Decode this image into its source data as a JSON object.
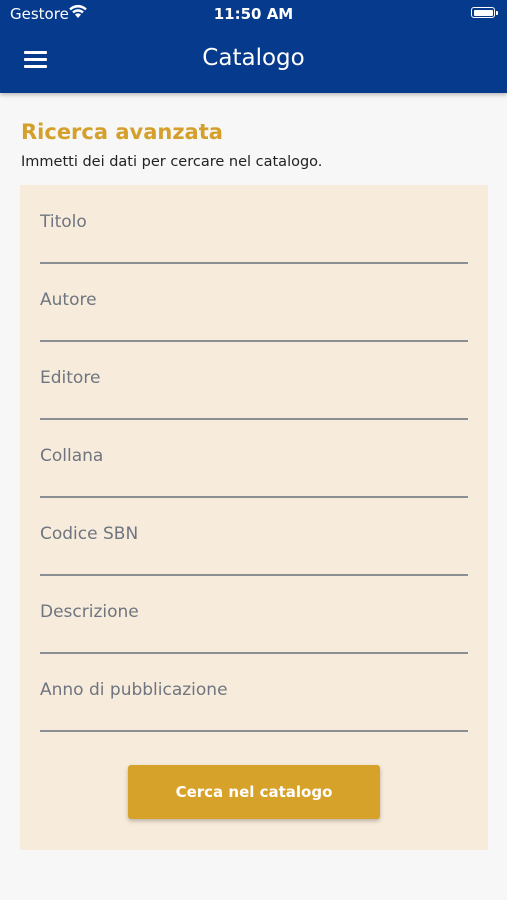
{
  "status_bar": {
    "carrier": "Gestore",
    "time": "11:50 AM",
    "wifi_icon": "wifi-icon",
    "battery_icon": "battery-icon"
  },
  "header": {
    "menu_icon": "hamburger-menu-icon",
    "title": "Catalogo"
  },
  "search": {
    "title": "Ricerca avanzata",
    "subtitle": "Immetti dei dati per cercare nel catalogo.",
    "fields": [
      {
        "label": "Titolo",
        "value": ""
      },
      {
        "label": "Autore",
        "value": ""
      },
      {
        "label": "Editore",
        "value": ""
      },
      {
        "label": "Collana",
        "value": ""
      },
      {
        "label": "Codice SBN",
        "value": ""
      },
      {
        "label": "Descrizione",
        "value": ""
      },
      {
        "label": "Anno di pubblicazione",
        "value": ""
      }
    ],
    "submit_label": "Cerca nel catalogo"
  },
  "colors": {
    "header_bg": "#063a8c",
    "accent": "#d4a02b",
    "panel_bg": "#f7ebdb",
    "button_bg": "#d6a22a"
  }
}
